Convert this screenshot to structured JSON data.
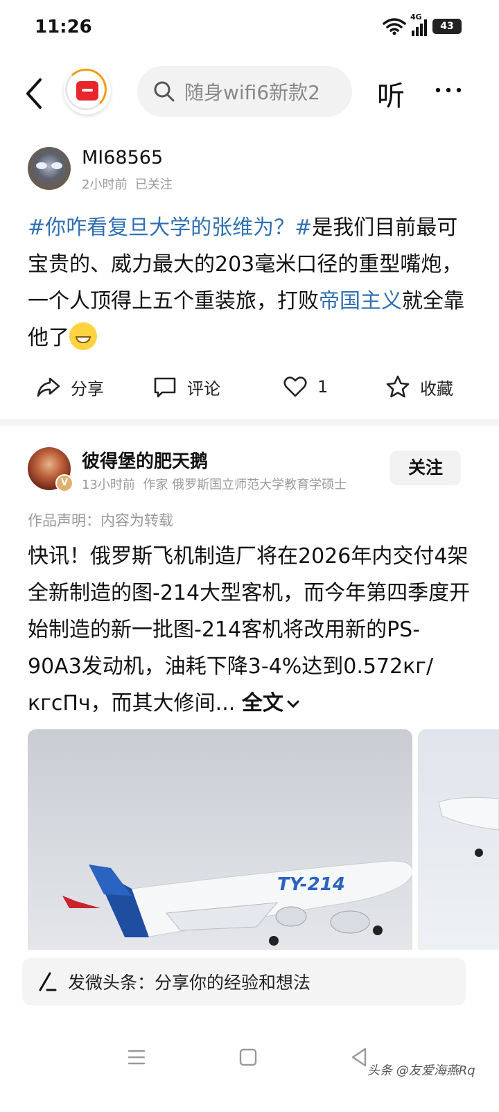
{
  "status_bar": {
    "time": "11:26",
    "network": "4G",
    "battery": "43"
  },
  "top_bar": {
    "search_text": "随身wifi6新款2",
    "listen_label": "听"
  },
  "post1": {
    "author": "MI68565",
    "time": "2小时前",
    "follow_state": "已关注",
    "body": {
      "hashtag": "#你咋看复旦大学的张维为？#",
      "text_before_link": "是我们目前最可宝贵的、威力最大的203毫米口径的重型嘴炮，一个人顶得上五个重装旅，打败",
      "link": "帝国主义",
      "text_after_link": "就全靠他了"
    },
    "actions": {
      "share": "分享",
      "comment": "评论",
      "like_count": "1",
      "favorite": "收藏"
    }
  },
  "post2": {
    "author": "彼得堡的肥天鹅",
    "verified_badge": "V",
    "time": "13小时前",
    "author_desc": "作家 俄罗斯国立师范大学教育学硕士",
    "follow_label": "关注",
    "notice": "作品声明：内容为转载",
    "body_text": "快讯！俄罗斯飞机制造厂将在2026年内交付4架全新制造的图-214大型客机，而今年第四季度开始制造的新一批图-214客机将改用新的PS-90A3发动机，油耗下降3-4%达到0.572кг/кгсПч，而其大修间...",
    "full_text_label": "全文",
    "image_caption": "TY-214"
  },
  "compose": {
    "placeholder": "发微头条：分享你的经验和想法"
  },
  "watermark": "头条 @友爱海燕Rq",
  "colors": {
    "link": "#2f6fb3",
    "brand_red": "#e8262b",
    "accent_orange": "#f39c12"
  }
}
